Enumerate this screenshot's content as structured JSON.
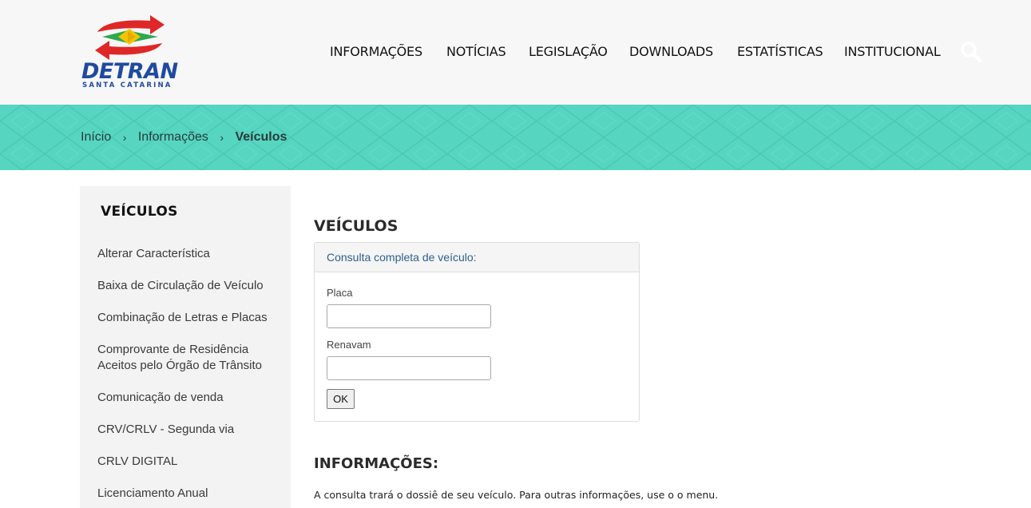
{
  "logo": {
    "word": "DETRAN",
    "subtitle": "SANTA CATARINA"
  },
  "nav": [
    {
      "label": "INFORMAÇÕES"
    },
    {
      "label": "NOTÍCIAS"
    },
    {
      "label": "LEGISLAÇÃO"
    },
    {
      "label": "DOWNLOADS"
    },
    {
      "label": "ESTATÍSTICAS"
    },
    {
      "label": "INSTITUCIONAL"
    }
  ],
  "breadcrumb": {
    "home": "Início",
    "section": "Informações",
    "current": "Veículos"
  },
  "sidebar": {
    "title": "VEÍCULOS",
    "items": [
      {
        "label": "Alterar Característica"
      },
      {
        "label": "Baixa de Circulação de Veículo"
      },
      {
        "label": "Combinação de Letras e Placas"
      },
      {
        "label": "Comprovante de Residência Aceitos pelo Órgão de Trânsito"
      },
      {
        "label": "Comunicação de venda"
      },
      {
        "label": "CRV/CRLV - Segunda via"
      },
      {
        "label": "CRLV DIGITAL"
      },
      {
        "label": "Licenciamento Anual"
      }
    ]
  },
  "main": {
    "title": "VEÍCULOS",
    "panel": {
      "heading": "Consulta completa de veículo:",
      "plate_label": "Placa",
      "plate_value": "",
      "renavam_label": "Renavam",
      "renavam_value": "",
      "submit_label": "OK"
    },
    "info_title": "INFORMAÇÕES:",
    "info_text": "A consulta trará o dossiê de seu veículo.  Para outras informações, use o o menu."
  },
  "colors": {
    "banner": "#56d6c1",
    "brand_blue": "#1f4aa0",
    "brand_red": "#e02727",
    "brand_green": "#2fa84f",
    "brand_yellow": "#f4c400"
  }
}
